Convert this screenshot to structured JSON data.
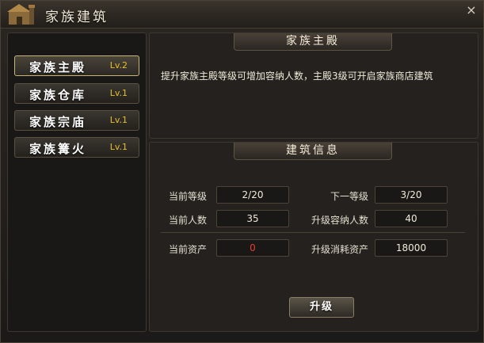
{
  "window": {
    "title": "家族建筑",
    "close_label": "×",
    "icon": "castle-icon",
    "close_icon": "close-icon"
  },
  "nav": {
    "items": [
      {
        "label": "家族主殿",
        "level": "Lv.2",
        "active": true
      },
      {
        "label": "家族仓库",
        "level": "Lv.1",
        "active": false
      },
      {
        "label": "家族宗庙",
        "level": "Lv.1",
        "active": false
      },
      {
        "label": "家族篝火",
        "level": "Lv.1",
        "active": false
      }
    ]
  },
  "info": {
    "header": "家族主殿",
    "description": "提升家族主殿等级可增加容纳人数，主殿3级可开启家族商店建筑"
  },
  "building": {
    "header": "建筑信息",
    "current_level_label": "当前等级",
    "current_level_value": "2/20",
    "next_level_label": "下一等级",
    "next_level_value": "3/20",
    "current_members_label": "当前人数",
    "current_members_value": "35",
    "upgrade_capacity_label": "升级容纳人数",
    "upgrade_capacity_value": "40",
    "current_assets_label": "当前资产",
    "current_assets_value": "0",
    "upgrade_cost_label": "升级消耗资产",
    "upgrade_cost_value": "18000",
    "upgrade_button": "升级"
  },
  "colors": {
    "accent_gold": "#e8c020",
    "warning_red": "#e04030",
    "active_border": "#c8b478"
  }
}
